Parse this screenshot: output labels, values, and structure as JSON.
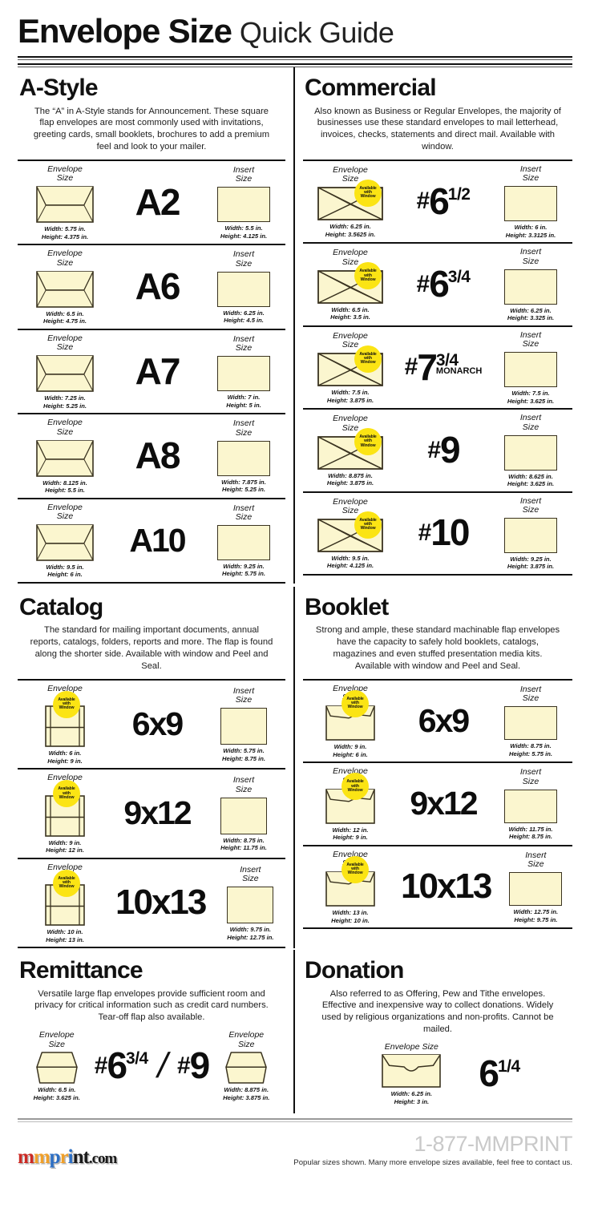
{
  "header": {
    "title_bold": "Envelope Size",
    "title_light": "Quick Guide"
  },
  "labels": {
    "envelope_size": "Envelope\nSize",
    "envelope_size_line1": "Envelope",
    "envelope_size_line2": "Size",
    "insert_size_line1": "Insert",
    "insert_size_line2": "Size",
    "envelope_size_inline": "Envelope Size",
    "badge_l1": "Available",
    "badge_l2": "with",
    "badge_l3": "Window",
    "slash": "/",
    "hash": "#",
    "monarch": "MONARCH"
  },
  "colors": {
    "paper": "#fbf6cf",
    "paper_border": "#3a3320",
    "badge_yellow": "#fbe414",
    "ink": "#111111",
    "logo_red": "#cc2a24",
    "logo_orange": "#f0a02a",
    "logo_blue": "#2d6fc4",
    "logo_dark": "#1a1a1a",
    "phone_grey": "#c9c9c9"
  },
  "sections": [
    {
      "id": "a-style",
      "title": "A-Style",
      "desc": "The “A” in A-Style stands for Announcement. These square flap envelopes are most commonly used with invitations, greeting cards, small booklets, brochures to add a premium feel and look to your mailer.",
      "envelope_style": "square-flap",
      "rows": [
        {
          "name": "A2",
          "name_parts": {
            "hash": "",
            "big": "A2",
            "frac": "",
            "sub": ""
          },
          "env_w": "Width: 5.75 in.",
          "env_h": "Height: 4.375 in.",
          "ins_w": "Width: 5.5 in.",
          "ins_h": "Height: 4.125 in.",
          "window": false
        },
        {
          "name": "A6",
          "name_parts": {
            "hash": "",
            "big": "A6",
            "frac": "",
            "sub": ""
          },
          "env_w": "Width: 6.5 in.",
          "env_h": "Height: 4.75 in.",
          "ins_w": "Width: 6.25 in.",
          "ins_h": "Height: 4.5 in.",
          "window": false
        },
        {
          "name": "A7",
          "name_parts": {
            "hash": "",
            "big": "A7",
            "frac": "",
            "sub": ""
          },
          "env_w": "Width: 7.25 in.",
          "env_h": "Height: 5.25 in.",
          "ins_w": "Width: 7 in.",
          "ins_h": "Height: 5 in.",
          "window": false
        },
        {
          "name": "A8",
          "name_parts": {
            "hash": "",
            "big": "A8",
            "frac": "",
            "sub": ""
          },
          "env_w": "Width: 8.125 in.",
          "env_h": "Height: 5.5 in.",
          "ins_w": "Width: 7.875 in.",
          "ins_h": "Height: 5.25 in.",
          "window": false
        },
        {
          "name": "A10",
          "name_parts": {
            "hash": "",
            "big": "A10",
            "frac": "",
            "sub": ""
          },
          "env_w": "Width: 9.5 in.",
          "env_h": "Height: 6 in.",
          "ins_w": "Width: 9.25 in.",
          "ins_h": "Height: 5.75 in.",
          "window": false
        }
      ]
    },
    {
      "id": "commercial",
      "title": "Commercial",
      "desc": "Also known as Business or Regular Envelopes, the majority of businesses use these standard envelopes to mail letterhead, invoices, checks, statements and direct mail. Available with window.",
      "envelope_style": "pointed-flap",
      "rows": [
        {
          "name": "#6 1/2",
          "name_parts": {
            "hash": "#",
            "big": "6",
            "frac": "1/2",
            "sub": ""
          },
          "env_w": "Width: 6.25 in.",
          "env_h": "Height: 3.5625 in.",
          "ins_w": "Width: 6 in.",
          "ins_h": "Height: 3.3125 in.",
          "window": true
        },
        {
          "name": "#6 3/4",
          "name_parts": {
            "hash": "#",
            "big": "6",
            "frac": "3/4",
            "sub": ""
          },
          "env_w": "Width: 6.5 in.",
          "env_h": "Height: 3.5 in.",
          "ins_w": "Width: 6.25 in.",
          "ins_h": "Height: 3.325 in.",
          "window": true
        },
        {
          "name": "#7 3/4 MONARCH",
          "name_parts": {
            "hash": "#",
            "big": "7",
            "frac": "3/4",
            "sub": "MONARCH"
          },
          "env_w": "Width: 7.5 in.",
          "env_h": "Height: 3.875 in.",
          "ins_w": "Width: 7.5 in.",
          "ins_h": "Height: 3.625 in.",
          "window": true
        },
        {
          "name": "#9",
          "name_parts": {
            "hash": "#",
            "big": "9",
            "frac": "",
            "sub": ""
          },
          "env_w": "Width: 8.875 in.",
          "env_h": "Height: 3.875 in.",
          "ins_w": "Width: 8.625 in.",
          "ins_h": "Height: 3.625 in.",
          "window": true
        },
        {
          "name": "#10",
          "name_parts": {
            "hash": "#",
            "big": "10",
            "frac": "",
            "sub": ""
          },
          "env_w": "Width: 9.5 in.",
          "env_h": "Height: 4.125 in.",
          "ins_w": "Width: 9.25 in.",
          "ins_h": "Height: 3.875 in.",
          "window": true
        }
      ]
    },
    {
      "id": "catalog",
      "title": "Catalog",
      "desc": "The standard for mailing important documents, annual reports, catalogs, folders, reports and more. The flap is found along the shorter side. Available with window and Peel and Seal.",
      "envelope_style": "catalog-portrait",
      "rows": [
        {
          "name": "6x9",
          "name_parts": {
            "hash": "",
            "big": "6x9",
            "frac": "",
            "sub": ""
          },
          "env_w": "Width: 6 in.",
          "env_h": "Height: 9 in.",
          "ins_w": "Width: 5.75 in.",
          "ins_h": "Height: 8.75 in.",
          "window": true
        },
        {
          "name": "9x12",
          "name_parts": {
            "hash": "",
            "big": "9x12",
            "frac": "",
            "sub": ""
          },
          "env_w": "Width: 9 in.",
          "env_h": "Height: 12 in.",
          "ins_w": "Width: 8.75 in.",
          "ins_h": "Height: 11.75 in.",
          "window": true
        },
        {
          "name": "10x13",
          "name_parts": {
            "hash": "",
            "big": "10x13",
            "frac": "",
            "sub": ""
          },
          "env_w": "Width: 10 in.",
          "env_h": "Height: 13 in.",
          "ins_w": "Width: 9.75 in.",
          "ins_h": "Height: 12.75 in.",
          "window": true
        }
      ]
    },
    {
      "id": "booklet",
      "title": "Booklet",
      "desc": "Strong and ample, these standard machinable flap envelopes have the capacity to safely hold booklets, catalogs, magazines and even stuffed presentation media kits.\nAvailable with window and Peel and Seal.",
      "envelope_style": "booklet-landscape",
      "rows": [
        {
          "name": "6x9",
          "name_parts": {
            "hash": "",
            "big": "6x9",
            "frac": "",
            "sub": ""
          },
          "env_w": "Width: 9 in.",
          "env_h": "Height: 6 in.",
          "ins_w": "Width: 8.75 in.",
          "ins_h": "Height: 5.75 in.",
          "window": true
        },
        {
          "name": "9x12",
          "name_parts": {
            "hash": "",
            "big": "9x12",
            "frac": "",
            "sub": ""
          },
          "env_w": "Width: 12 in.",
          "env_h": "Height: 9 in.",
          "ins_w": "Width: 11.75 in.",
          "ins_h": "Height: 8.75 in.",
          "window": true
        },
        {
          "name": "10x13",
          "name_parts": {
            "hash": "",
            "big": "10x13",
            "frac": "",
            "sub": ""
          },
          "env_w": "Width: 13 in.",
          "env_h": "Height: 10 in.",
          "ins_w": "Width: 12.75 in.",
          "ins_h": "Height: 9.75 in.",
          "window": true
        }
      ]
    }
  ],
  "remittance": {
    "title": "Remittance",
    "desc": "Versatile large flap envelopes provide sufficient room and privacy for critical information such as credit card numbers. Tear-off flap also available.",
    "left": {
      "env_w": "Width: 6.5 in.",
      "env_h": "Height: 3.625 in."
    },
    "right": {
      "env_w": "Width: 8.875 in.",
      "env_h": "Height: 3.875 in."
    },
    "size_a": {
      "hash": "#",
      "big": "6",
      "frac": "3/4"
    },
    "size_b": {
      "hash": "#",
      "big": "9",
      "frac": ""
    }
  },
  "donation": {
    "title": "Donation",
    "desc": "Also referred to as Offering, Pew and Tithe envelopes. Effective and inexpensive way to collect donations. Widely used by religious organizations and non-profits. Cannot be mailed.",
    "env_w": "Width: 6.25 in.",
    "env_h": "Height: 3 in.",
    "size": {
      "hash": "",
      "big": "6",
      "frac": "1/4"
    }
  },
  "footer": {
    "logo_m1": "m",
    "logo_m2": "m",
    "logo_p": "p",
    "logo_r": "r",
    "logo_i": "i",
    "logo_n": "n",
    "logo_t": "t",
    "logo_com": ".com",
    "phone": "1-877-MMPRINT",
    "note": "Popular sizes shown. Many more envelope sizes available, feel free to contact us."
  }
}
